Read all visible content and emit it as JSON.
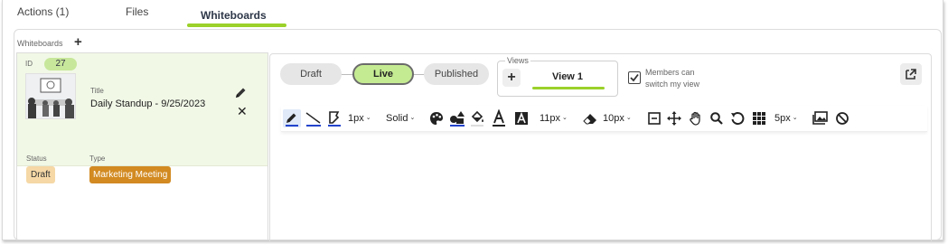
{
  "tabs": [
    {
      "label": "Actions (1)"
    },
    {
      "label": "Files"
    },
    {
      "label": "Whiteboards"
    }
  ],
  "whiteboards_header": {
    "label": "Whiteboards",
    "add_icon": "plus-icon"
  },
  "whiteboard": {
    "id_label": "ID",
    "id": "27",
    "title_label": "Title",
    "title": "Daily Standup - 9/25/2023",
    "status_label": "Status",
    "status": "Draft",
    "type_label": "Type",
    "type": "Marketing Meeting",
    "status_color": "#f5d8a6",
    "type_color": "#d28a21"
  },
  "stages": [
    {
      "label": "Draft"
    },
    {
      "label": "Live",
      "active": true
    },
    {
      "label": "Published"
    }
  ],
  "views": {
    "legend": "Views",
    "add_icon": "plus-icon",
    "current": "View 1"
  },
  "members_switch": {
    "label": "Members can switch my view",
    "checked": true
  },
  "toolbar": {
    "stroke_width": "1px",
    "stroke_style": "Solid",
    "font_size": "11px",
    "eraser_size": "10px",
    "grid_size": "5px"
  },
  "accent": "#9bd12a"
}
